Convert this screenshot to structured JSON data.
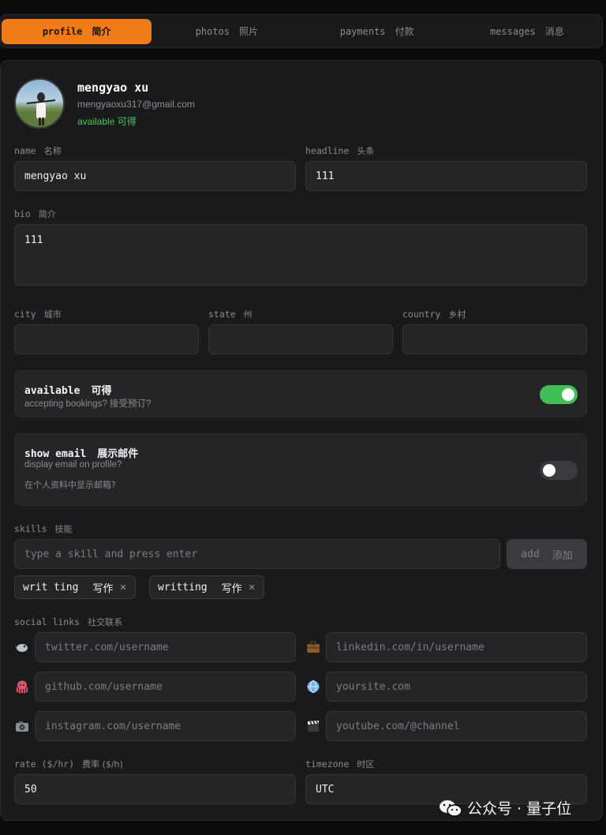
{
  "tabs": [
    {
      "label": "profile",
      "zh": "简介"
    },
    {
      "label": "photos",
      "zh": "照片"
    },
    {
      "label": "payments",
      "zh": "付款"
    },
    {
      "label": "messages",
      "zh": "消息"
    }
  ],
  "user": {
    "name": "mengyao xu",
    "email": "mengyaoxu317@gmail.com",
    "status": "available  可得"
  },
  "fields": {
    "name": {
      "label": "name",
      "zh": "名称",
      "value": "mengyao xu"
    },
    "headline": {
      "label": "headline",
      "zh": "头条",
      "value": "111"
    },
    "bio": {
      "label": "bio",
      "zh": "简介",
      "value": "111"
    },
    "city": {
      "label": "city",
      "zh": "城市",
      "value": ""
    },
    "state": {
      "label": "state",
      "zh": "州",
      "value": ""
    },
    "country": {
      "label": "country",
      "zh": "乡村",
      "value": ""
    }
  },
  "available": {
    "title": "available",
    "zh": "可得",
    "sub": "accepting bookings?  接受预订?",
    "on": true
  },
  "show_email": {
    "title": "show email",
    "zh": "展示邮件",
    "sub1": "display email on profile?",
    "sub2": "在个人资料中显示邮箱?",
    "on": false
  },
  "skills": {
    "label": "skills",
    "zh": "技能",
    "placeholder": "type a skill and press enter",
    "add_label": "add",
    "add_zh": "添加",
    "chips": [
      {
        "text": "writ ting",
        "zh": "写作"
      },
      {
        "text": "writting",
        "zh": "写作"
      }
    ]
  },
  "social": {
    "label": "social links",
    "zh": "社交联系",
    "links": [
      {
        "icon": "bird-icon",
        "placeholder": "twitter.com/username"
      },
      {
        "icon": "briefcase-icon",
        "placeholder": "linkedin.com/in/username"
      },
      {
        "icon": "octopus-icon",
        "placeholder": "github.com/username"
      },
      {
        "icon": "globe-icon",
        "placeholder": "yoursite.com"
      },
      {
        "icon": "camera-icon",
        "placeholder": "instagram.com/username"
      },
      {
        "icon": "clapper-icon",
        "placeholder": "youtube.com/@channel"
      }
    ]
  },
  "rate": {
    "label": "rate ($/hr)",
    "zh": "费率 ($/h)",
    "value": "50"
  },
  "timezone": {
    "label": "timezone",
    "zh": "时区",
    "value": "UTC"
  },
  "watermark": "公众号 · 量子位",
  "colors": {
    "accent": "#f07c18",
    "toggle_on": "#3fbf55",
    "status": "#4ac95e"
  }
}
